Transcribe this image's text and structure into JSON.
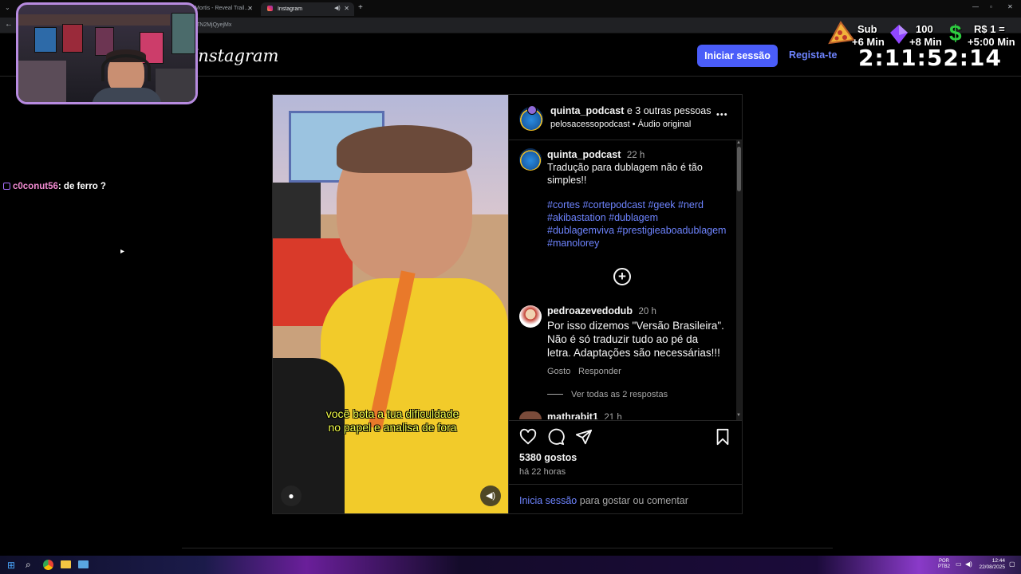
{
  "browser": {
    "tabs": [
      {
        "label": "or Mortis - Reveal Trail..."
      },
      {
        "label": "Instagram"
      }
    ],
    "url": "TN2MjQyejMx"
  },
  "instagram": {
    "logo": "Instagram",
    "login_label": "Iniciar sessão",
    "signup_label": "Regista-te"
  },
  "overlay": {
    "sub_label": "Sub",
    "sub_time": "+6 Min",
    "bits_amount": "100",
    "bits_time": "+8 Min",
    "money_label": "R$ 1 =",
    "money_time": "+5:00 Min",
    "timer": "2:11:52:14"
  },
  "chat": {
    "user": "c0conut56",
    "message": ": de ferro ?"
  },
  "post": {
    "header_user": "quinta_podcast",
    "header_others": " e 3 outras pessoas",
    "header_audio_user": "pelosacessopodcast",
    "header_audio_sep": " • ",
    "header_audio_label": "Áudio original",
    "more_label": "•••",
    "caption_user": "quinta_podcast",
    "caption_time": "22 h",
    "caption_text_1": "Tradução para dublagem não é tão",
    "caption_text_2": "simples!!",
    "hashtags_1": "#cortes #cortepodcast #geek #nerd",
    "hashtags_2": "#akibastation #dublagem",
    "hashtags_3": "#dublagemviva #prestigieaboadublagem",
    "hashtags_4": "#manolorey",
    "comment_user": "pedroazevedodub",
    "comment_time": "20 h",
    "comment_1": "Por isso dizemos \"Versão Brasileira\".",
    "comment_2": "Não é só traduzir tudo ao pé da",
    "comment_3": "letra. Adaptações são necessárias!!!",
    "like_label": "Gosto",
    "reply_label": "Responder",
    "view_replies": "Ver todas as 2 respostas",
    "next_user": "mathrabit1",
    "next_time": "21 h",
    "likes": "5380 gostos",
    "posted": "há 22 horas",
    "login_link": "Inicia sessão",
    "login_suffix": " para gostar ou comentar",
    "subtitle_1": "você bota a tua dificuldade",
    "subtitle_2": "no papel e analisa de fora"
  },
  "taskbar": {
    "lang_1": "POR",
    "lang_2": "PTB2",
    "time": "12:44",
    "date": "22/08/2025"
  },
  "colors": {
    "accent": "#4a5df9",
    "link": "#6e84ff",
    "bg": "#000000"
  }
}
